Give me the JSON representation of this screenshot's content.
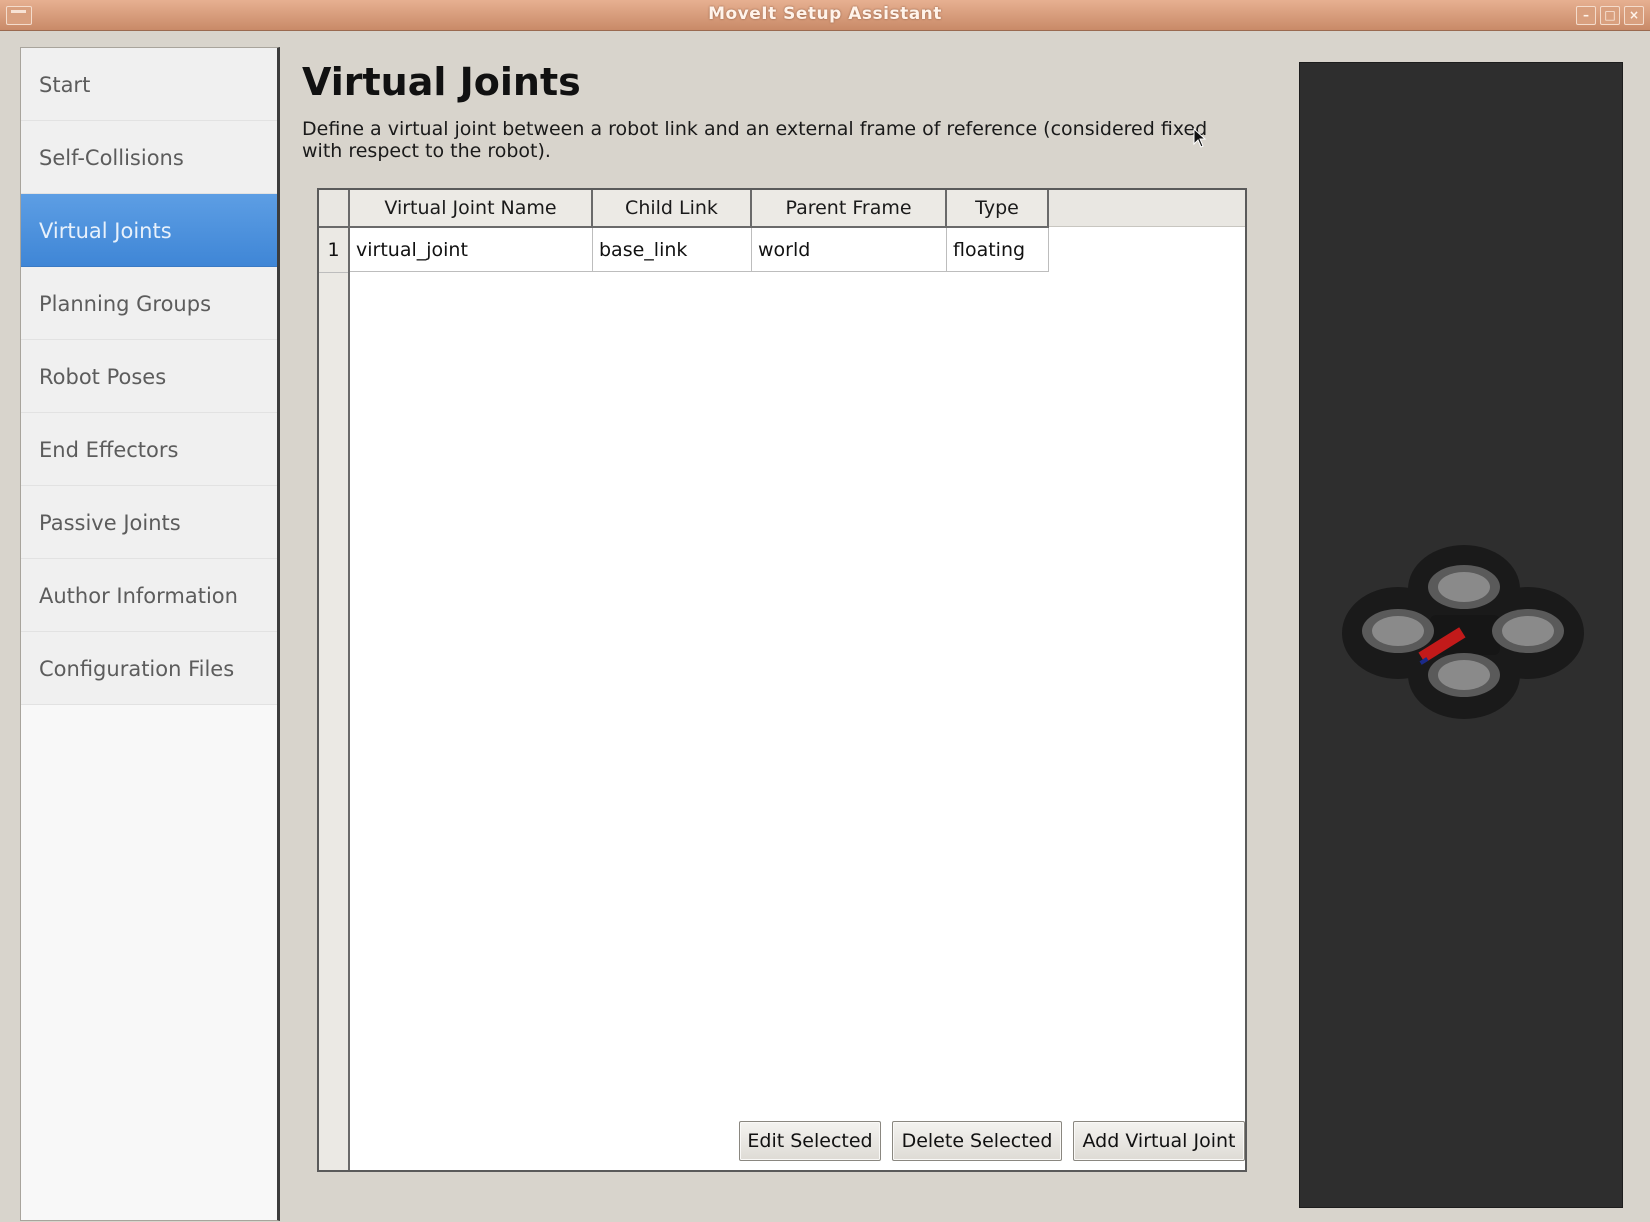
{
  "window": {
    "title": "MoveIt Setup Assistant"
  },
  "sidebar": {
    "items": [
      {
        "label": "Start",
        "active": false
      },
      {
        "label": "Self-Collisions",
        "active": false
      },
      {
        "label": "Virtual Joints",
        "active": true
      },
      {
        "label": "Planning Groups",
        "active": false
      },
      {
        "label": "Robot Poses",
        "active": false
      },
      {
        "label": "End Effectors",
        "active": false
      },
      {
        "label": "Passive Joints",
        "active": false
      },
      {
        "label": "Author Information",
        "active": false
      },
      {
        "label": "Configuration Files",
        "active": false
      }
    ]
  },
  "main": {
    "title": "Virtual Joints",
    "description": "Define a virtual joint between a robot link and an external frame of reference (considered fixed with respect to the robot).",
    "table": {
      "columns": [
        "Virtual Joint Name",
        "Child Link",
        "Parent Frame",
        "Type"
      ],
      "rows": [
        {
          "num": "1",
          "cells": [
            "virtual_joint",
            "base_link",
            "world",
            "floating"
          ]
        }
      ]
    },
    "buttons": {
      "edit": "Edit Selected",
      "delete": "Delete Selected",
      "add": "Add Virtual Joint"
    }
  },
  "viewer": {
    "model": "quadrotor-robot"
  },
  "colors": {
    "accent": "#4a90dc",
    "titlebar": "#d49b7c",
    "viewer_bg": "#2e2e2e"
  }
}
